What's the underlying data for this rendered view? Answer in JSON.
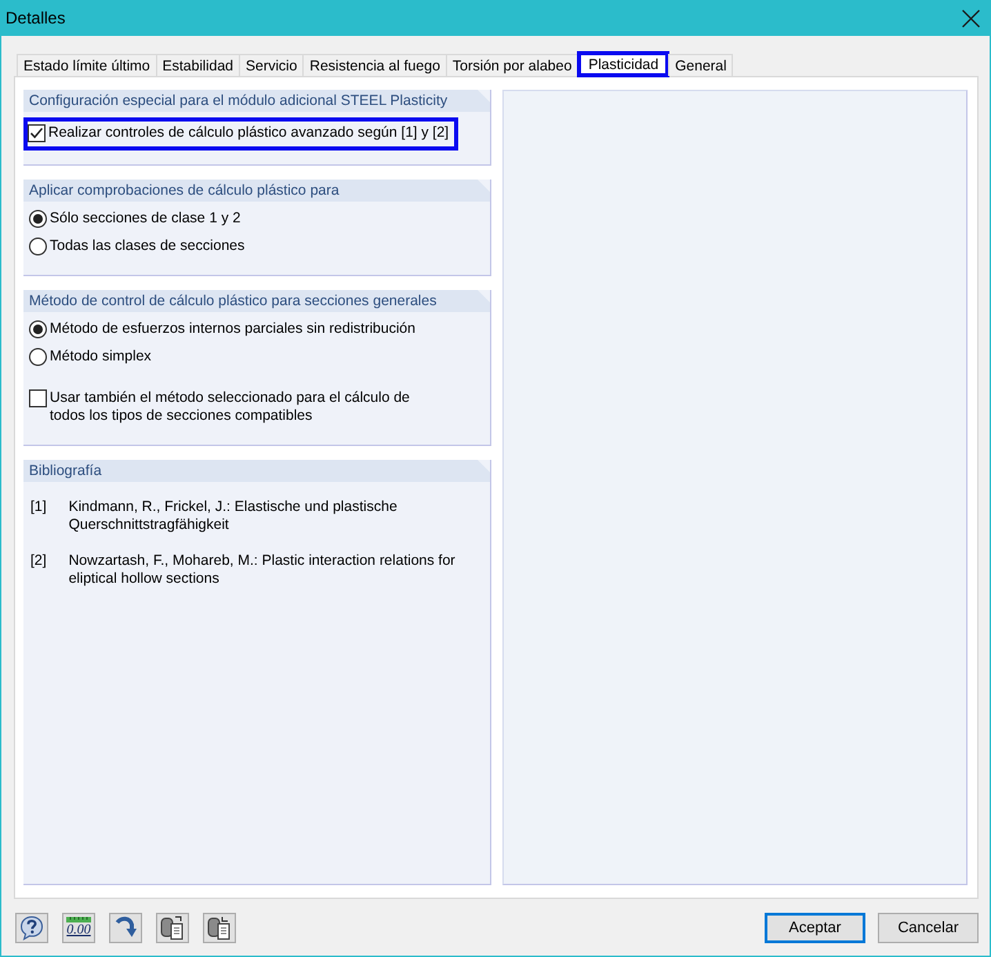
{
  "window": {
    "title": "Detalles"
  },
  "tabs": [
    {
      "label": "Estado límite último",
      "selected": false,
      "highlighted": false
    },
    {
      "label": "Estabilidad",
      "selected": false,
      "highlighted": false
    },
    {
      "label": "Servicio",
      "selected": false,
      "highlighted": false
    },
    {
      "label": "Resistencia al fuego",
      "selected": false,
      "highlighted": false
    },
    {
      "label": "Torsión por alabeo",
      "selected": false,
      "highlighted": false
    },
    {
      "label": "Plasticidad",
      "selected": true,
      "highlighted": true
    },
    {
      "label": "General",
      "selected": false,
      "highlighted": false
    }
  ],
  "groups": [
    {
      "title": "Configuración especial para el módulo adicional STEEL Plasticity",
      "items": [
        {
          "kind": "checkbox",
          "label": "Realizar controles de cálculo plástico avanzado según [1] y [2]",
          "checked": true,
          "highlighted": true
        }
      ]
    },
    {
      "title": "Aplicar comprobaciones de cálculo plástico para",
      "items": [
        {
          "kind": "radio",
          "label": "Sólo secciones de clase 1 y 2",
          "selected": true,
          "highlighted": false
        },
        {
          "kind": "radio",
          "label": "Todas las clases de secciones",
          "selected": false,
          "highlighted": false
        }
      ]
    },
    {
      "title": "Método de control de cálculo plástico para secciones generales",
      "items": [
        {
          "kind": "radio",
          "label": "Método de esfuerzos internos parciales sin redistribución",
          "selected": true,
          "highlighted": false
        },
        {
          "kind": "radio",
          "label": "Método simplex",
          "selected": false,
          "highlighted": false
        },
        {
          "kind": "checkbox",
          "label": "Usar también el método seleccionado para el cálculo de todos los tipos de secciones compatibles",
          "checked": false,
          "highlighted": false
        }
      ]
    },
    {
      "title": "Bibliografía",
      "references": [
        {
          "marker": "[1]",
          "text": "Kindmann, R., Frickel, J.: Elastische und plastische Querschnittstragfähigkeit"
        },
        {
          "marker": "[2]",
          "text": "Nowzartash, F., Mohareb, M.: Plastic interaction relations for eliptical hollow sections"
        }
      ]
    }
  ],
  "toolbar": {
    "decimals_label": "0.00"
  },
  "buttons": [
    {
      "label": "Aceptar",
      "default": true
    },
    {
      "label": "Cancelar",
      "default": false
    }
  ]
}
